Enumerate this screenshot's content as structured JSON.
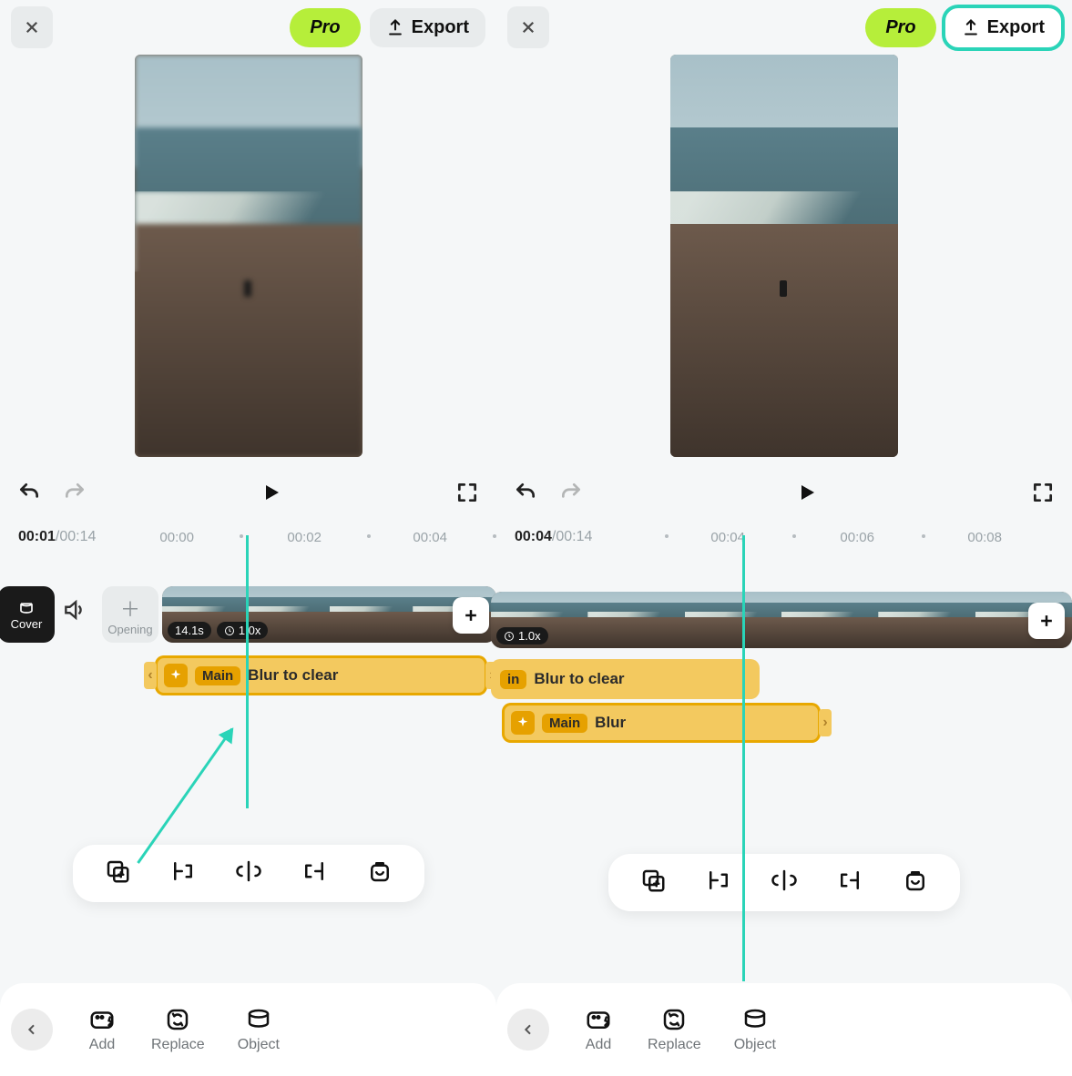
{
  "left": {
    "top": {
      "pro": "Pro",
      "export": "Export"
    },
    "time": {
      "current": "00:01",
      "total": "/00:14",
      "ticks": [
        "00:00",
        "00:02",
        "00:04"
      ]
    },
    "cover": "Cover",
    "opening": "Opening",
    "clip": {
      "duration": "14.1s",
      "speed": "1.0x"
    },
    "fx1": {
      "tag": "Main",
      "name": "Blur to clear"
    },
    "bottom": {
      "add": "Add",
      "replace": "Replace",
      "object": "Object"
    }
  },
  "right": {
    "top": {
      "pro": "Pro",
      "export": "Export"
    },
    "time": {
      "current": "00:04",
      "total": "/00:14",
      "ticks": [
        "00:04",
        "00:06",
        "00:08"
      ]
    },
    "clip": {
      "speed": "1.0x"
    },
    "fx1": {
      "tag": "in",
      "name": "Blur to clear"
    },
    "fx2": {
      "tag": "Main",
      "name": "Blur"
    },
    "bottom": {
      "add": "Add",
      "replace": "Replace",
      "object": "Object"
    }
  }
}
